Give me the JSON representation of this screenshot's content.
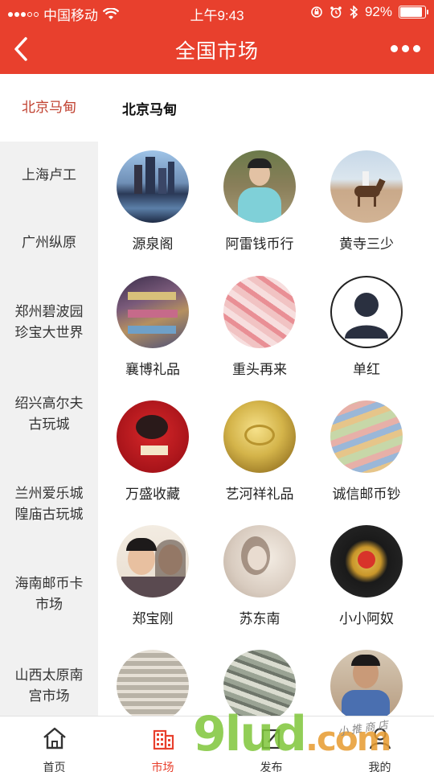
{
  "status_bar": {
    "carrier": "中国移动",
    "time": "上午9:43",
    "battery": "92%",
    "battery_level": 0.92
  },
  "nav": {
    "title": "全国市场",
    "back_icon": "chevron-left-icon",
    "more_icon": "more-dots-icon"
  },
  "sidebar": {
    "items": [
      {
        "label": "北京马甸",
        "active": true
      },
      {
        "label": "上海卢工",
        "active": false
      },
      {
        "label": "广州纵原",
        "active": false
      },
      {
        "label": "郑州碧波园珍宝大世界",
        "active": false
      },
      {
        "label": "绍兴高尔夫古玩城",
        "active": false
      },
      {
        "label": "兰州爱乐城隍庙古玩城",
        "active": false
      },
      {
        "label": "海南邮币卡市场",
        "active": false
      },
      {
        "label": "山西太原南宫市场",
        "active": false
      }
    ]
  },
  "content": {
    "section_title": "北京马甸",
    "shops": [
      {
        "name": "源泉阁"
      },
      {
        "name": "阿雷钱币行"
      },
      {
        "name": "黄寺三少"
      },
      {
        "name": "襄博礼品"
      },
      {
        "name": "重头再来"
      },
      {
        "name": "单红"
      },
      {
        "name": "万盛收藏"
      },
      {
        "name": "艺河祥礼品"
      },
      {
        "name": "诚信邮币钞"
      },
      {
        "name": "郑宝刚"
      },
      {
        "name": "苏东南"
      },
      {
        "name": "小小阿奴"
      },
      {
        "name": ""
      },
      {
        "name": ""
      },
      {
        "name": ""
      }
    ]
  },
  "tabbar": {
    "items": [
      {
        "label": "首页",
        "icon": "home-icon"
      },
      {
        "label": "市场",
        "icon": "building-icon",
        "active": true
      },
      {
        "label": "发布",
        "icon": "edit-icon"
      },
      {
        "label": "我的",
        "icon": "user-icon"
      }
    ]
  },
  "watermark": {
    "text": "9lud",
    "dotcom": ".com",
    "sub": "小 推 商 店"
  },
  "colors": {
    "accent": "#e8402d",
    "active_text": "#c0402f",
    "sidebar_bg": "#f1f1f1"
  }
}
